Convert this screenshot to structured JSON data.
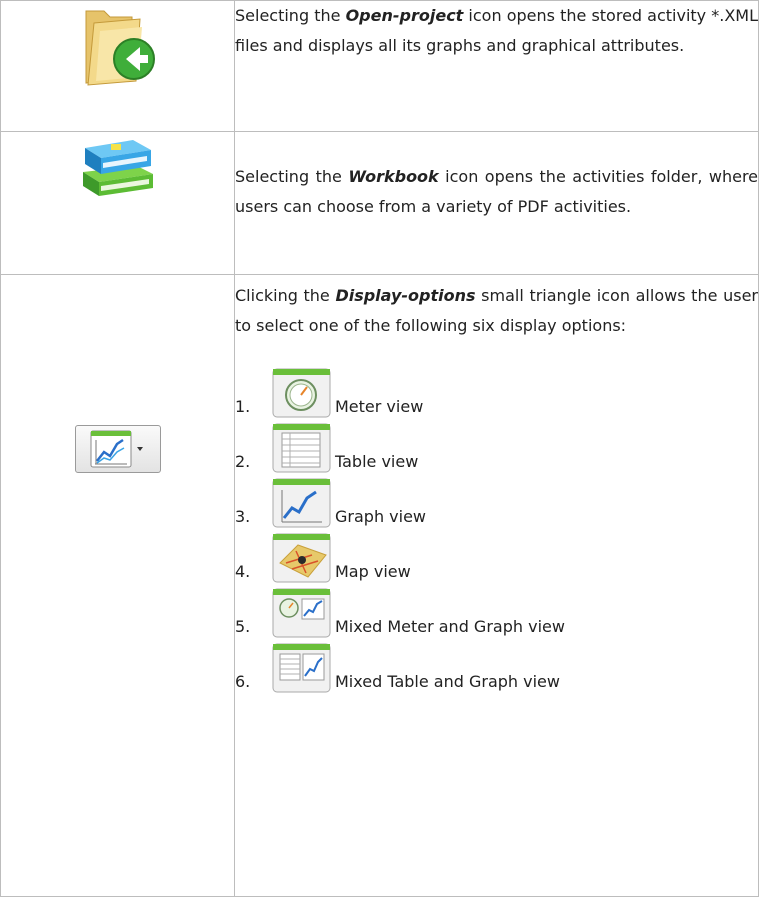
{
  "rows": [
    {
      "icon": "open-project-folder-icon",
      "text_before": "Selecting the ",
      "emphasis": "Open-project",
      "text_after": " icon opens the stored activity *.XML files and displays all its graphs and graphical attributes."
    },
    {
      "icon": "workbook-books-icon",
      "text_before": "Selecting the ",
      "emphasis": "Workbook",
      "text_after": " icon opens the activities folder, where users can choose from a variety of PDF activities."
    },
    {
      "icon": "display-options-icon",
      "text_before": "Clicking the ",
      "emphasis": "Display-options",
      "text_after": " small triangle icon allows the user to select one of the following six display options:",
      "options": [
        {
          "num": "1.",
          "label": "Meter view",
          "icon": "meter-view-icon"
        },
        {
          "num": "2.",
          "label": "Table view",
          "icon": "table-view-icon"
        },
        {
          "num": "3.",
          "label": "Graph view",
          "icon": "graph-view-icon"
        },
        {
          "num": "4.",
          "label": "Map view",
          "icon": "map-view-icon"
        },
        {
          "num": "5.",
          "label": "Mixed Meter and Graph view",
          "icon": "mixed-meter-graph-view-icon"
        },
        {
          "num": "6.",
          "label": "Mixed Table and Graph view",
          "icon": "mixed-table-graph-view-icon"
        }
      ]
    }
  ],
  "colors": {
    "border": "#bdbdbd",
    "green": "#6abf3a",
    "blue": "#2f88c8"
  }
}
